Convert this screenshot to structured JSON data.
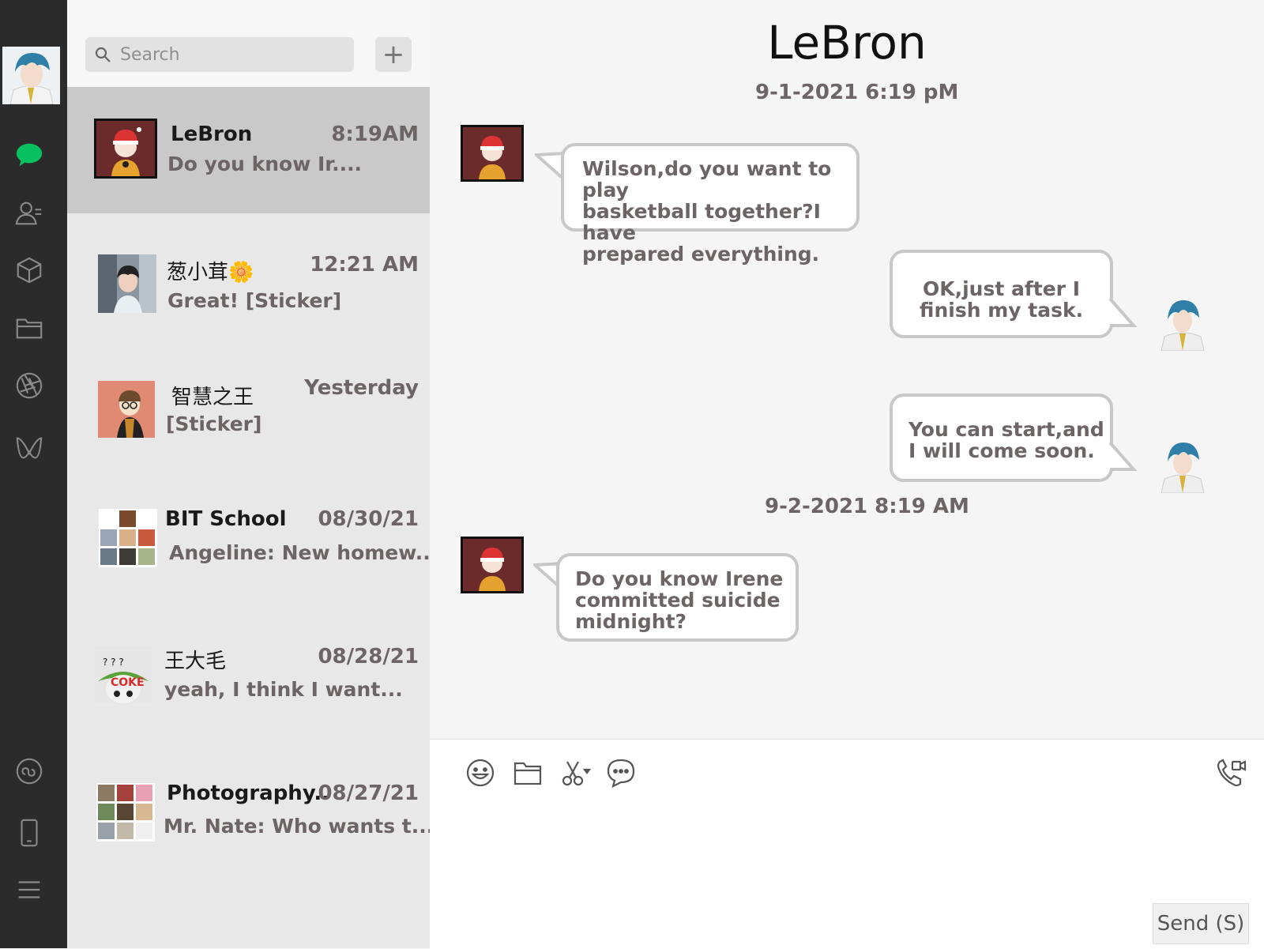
{
  "search": {
    "placeholder": "Search",
    "add_label": "+"
  },
  "chats": [
    {
      "name": "LeBron",
      "time": "8:19AM",
      "preview": "Do you know Ir....",
      "active": true
    },
    {
      "name": "葱小茸🌼",
      "time": "12:21 AM",
      "preview": "Great! [Sticker]"
    },
    {
      "name": "智慧之王",
      "time": "Yesterday",
      "preview": "[Sticker]"
    },
    {
      "name": "BIT School",
      "time": "08/30/21",
      "preview": "Angeline: New homew..."
    },
    {
      "name": "王大毛",
      "time": "08/28/21",
      "preview": "yeah, I think I want..."
    },
    {
      "name": "Photography..",
      "time": "08/27/21",
      "preview": "Mr. Nate: Who wants t..."
    }
  ],
  "conversation": {
    "title": "LeBron",
    "timestamps": [
      "9-1-2021 6:19 pM",
      "9-2-2021 8:19 AM"
    ],
    "messages": [
      {
        "from": "LeBron",
        "lines": [
          "Wilson,do you want to play",
          "basketball together?I have",
          "prepared everything."
        ]
      },
      {
        "from": "me",
        "lines": [
          "OK,just after I",
          "finish my task."
        ]
      },
      {
        "from": "me",
        "lines": [
          "You can start,and",
          "I will come soon."
        ]
      },
      {
        "from": "LeBron",
        "lines": [
          "Do you know Irene",
          "committed suicide",
          "midnight?"
        ]
      }
    ]
  },
  "composer": {
    "send_label": "Send (S)"
  },
  "icons": {
    "rail": [
      "chat-icon",
      "contacts-icon",
      "box-icon",
      "folder-icon",
      "moments-icon",
      "channels-icon",
      "mini-program-icon",
      "phone-icon",
      "menu-icon"
    ],
    "toolbar": [
      "emoji-icon",
      "folder-icon",
      "scissors-icon",
      "chat-bubble-icon",
      "video-call-icon"
    ]
  },
  "colors": {
    "rail_bg": "#2b2b2b",
    "active_chat": "#c9c9c9",
    "list_bg": "#e8e8e8",
    "accent_green": "#07c160",
    "text_muted": "#6d6466"
  }
}
